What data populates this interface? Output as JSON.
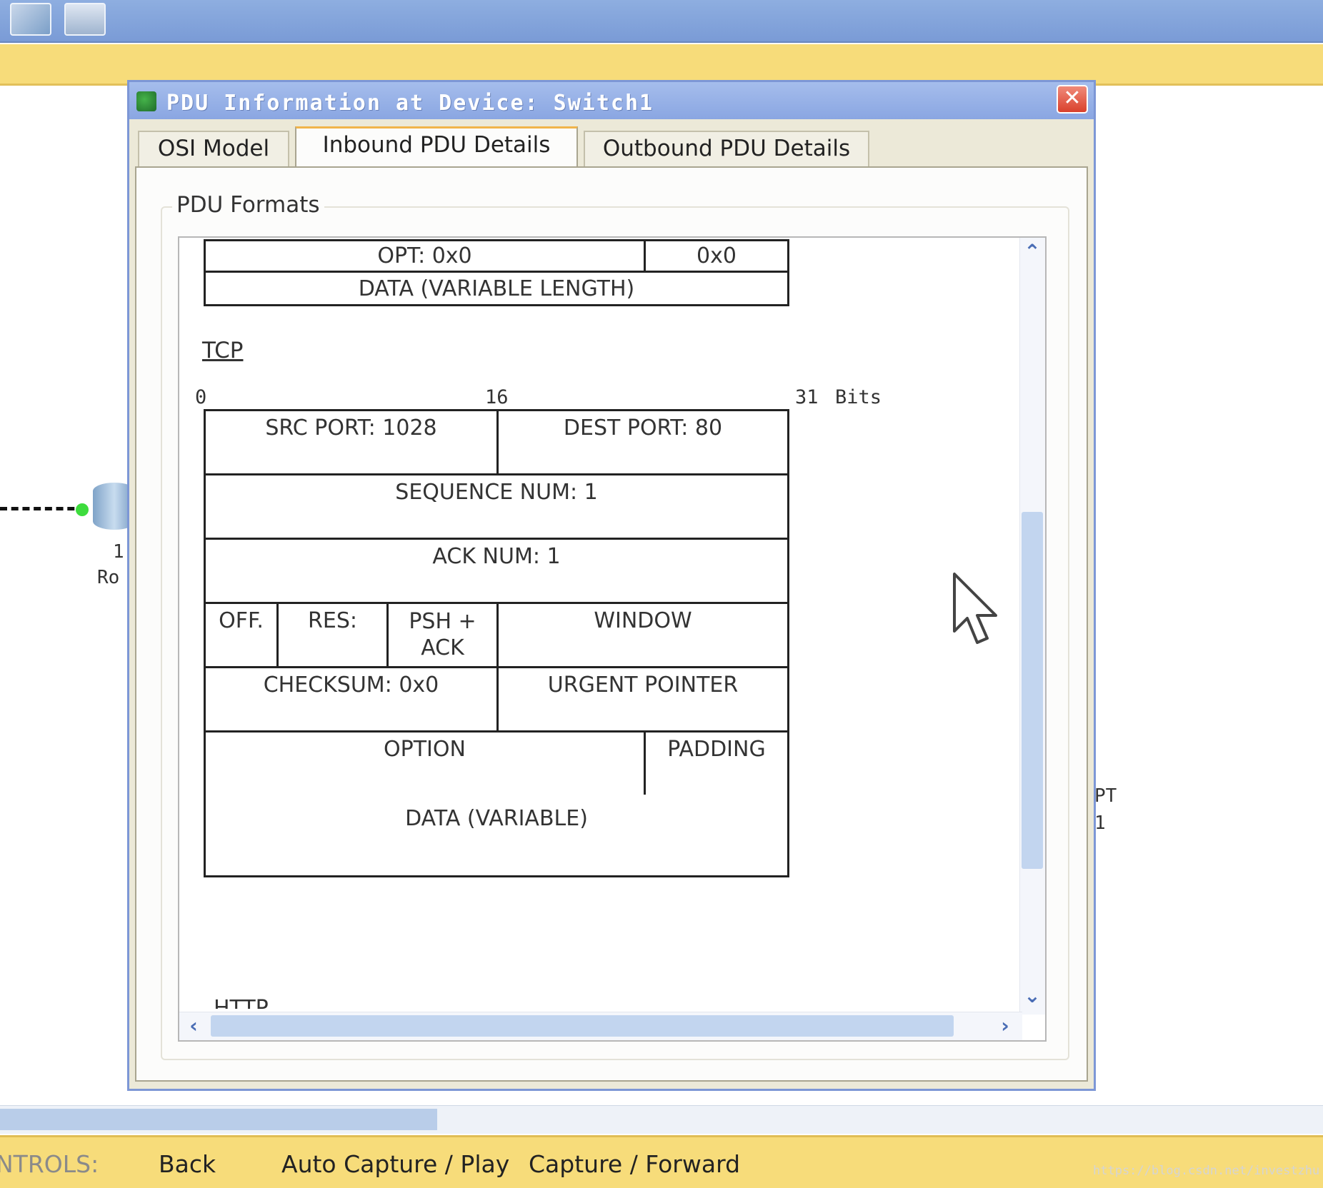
{
  "dialog": {
    "title": "PDU Information at Device: Switch1",
    "close_glyph": "✕",
    "tabs": [
      {
        "label": "OSI Model"
      },
      {
        "label": "Inbound PDU Details"
      },
      {
        "label": "Outbound PDU Details"
      }
    ],
    "group_title": "PDU Formats"
  },
  "ip_tail": {
    "opt": "OPT: 0x0",
    "opt_value": "0x0",
    "data": "DATA (VARIABLE LENGTH)"
  },
  "tcp": {
    "section_label": "TCP",
    "bits": {
      "start": "0",
      "mid": "16",
      "end": "31",
      "unit": "Bits"
    },
    "src_port": "SRC PORT: 1028",
    "dest_port": "DEST PORT: 80",
    "sequence": "SEQUENCE NUM: 1",
    "ack": "ACK NUM: 1",
    "offset": "OFF.",
    "reserved": "RES:",
    "flags_line1": "PSH +",
    "flags_line2": "ACK",
    "window": "WINDOW",
    "checksum": "CHECKSUM: 0x0",
    "urgent": "URGENT POINTER",
    "option": "OPTION",
    "padding": "PADDING",
    "data": "DATA (VARIABLE)"
  },
  "next_section_label": "HTTP",
  "background": {
    "device_label_1": "1",
    "device_label_2": "Ro",
    "device_label_3": "PT",
    "device_label_4": "1"
  },
  "controls": {
    "label": "NTROLS:",
    "back": "Back",
    "auto_capture": "Auto Capture / Play",
    "capture_forward": "Capture / Forward"
  },
  "watermark": "https://blog.csdn.net/investzhu"
}
